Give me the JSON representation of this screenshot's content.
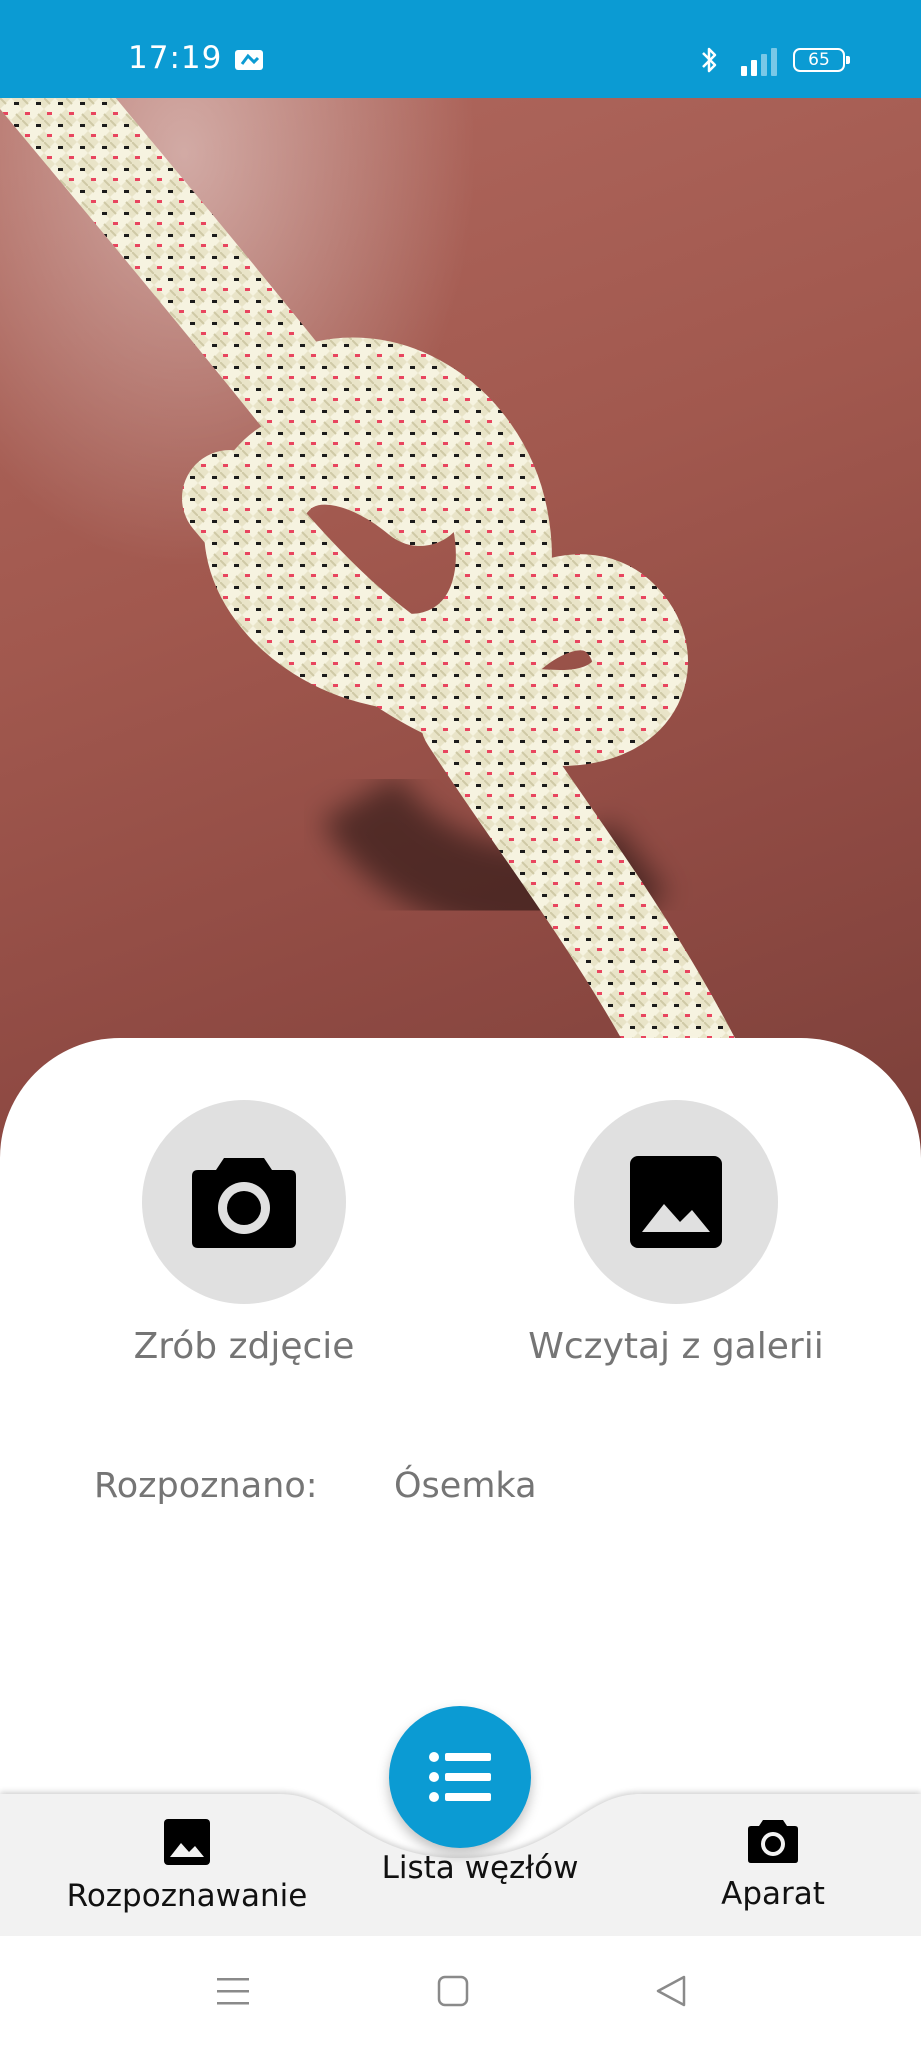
{
  "status_bar": {
    "time": "17:19",
    "battery": "65",
    "icons": [
      "notification-icon",
      "bluetooth-icon",
      "signal-icon",
      "battery-icon"
    ]
  },
  "actions": {
    "take_photo": {
      "label": "Zrób zdjęcie",
      "icon": "camera-icon"
    },
    "load_gallery": {
      "label": "Wczytaj z galerii",
      "icon": "image-icon"
    }
  },
  "result": {
    "label": "Rozpoznano:",
    "value": "Ósemka"
  },
  "bottom_nav": {
    "items": [
      {
        "label": "Rozpoznawanie",
        "icon": "image-icon"
      },
      {
        "label": "Lista węzłów",
        "icon": "list-icon"
      },
      {
        "label": "Aparat",
        "icon": "camera-icon"
      }
    ]
  },
  "colors": {
    "primary": "#0B9BD3",
    "circle_bg": "#E0E0E0",
    "label_text": "#757575",
    "nav_bg": "#F2F2F2"
  }
}
